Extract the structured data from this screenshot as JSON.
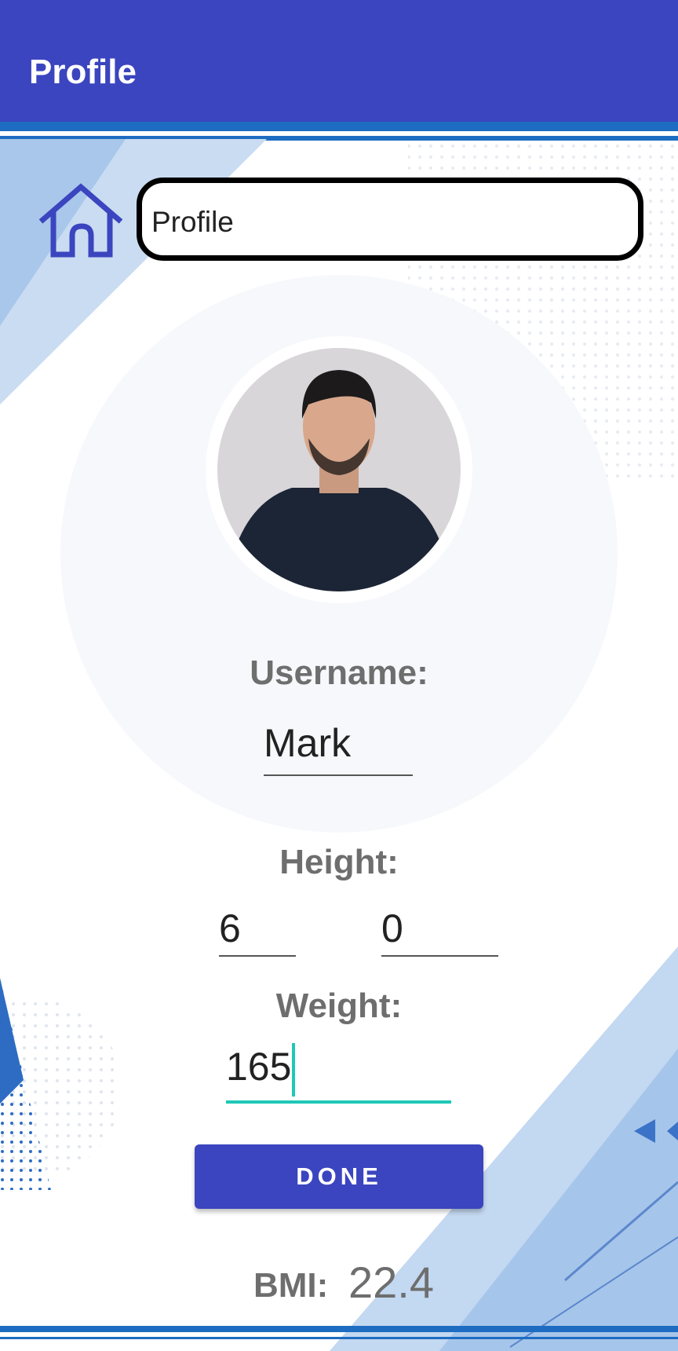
{
  "appbar": {
    "title": "Profile"
  },
  "header": {
    "page_title": "Profile",
    "home_icon": "home-icon"
  },
  "profile": {
    "avatar": "profile-photo",
    "username_label": "Username:",
    "username_value": "Mark",
    "height_label": "Height:",
    "height_feet": "6",
    "height_inches": "0",
    "weight_label": "Weight:",
    "weight_value": "165",
    "done_label": "DONE",
    "bmi_label": "BMI:",
    "bmi_value": "22.4"
  },
  "colors": {
    "primary": "#3b45bf",
    "accent": "#1ec8b7",
    "label_gray": "#6e6e6e"
  }
}
